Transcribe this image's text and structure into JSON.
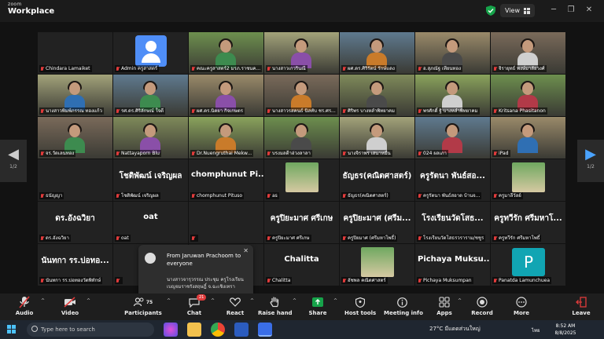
{
  "titlebar": {
    "brand_small": "zoom",
    "brand_big": "Workplace",
    "view_label": "View",
    "colors": {
      "shield": "#16a34a"
    }
  },
  "pager": {
    "left": "1/2",
    "right": "1/2"
  },
  "rows": [
    [
      {
        "label": "Chindara  Lamaiket",
        "type": "name"
      },
      {
        "label": "Admin ครูสาสตร์",
        "type": "avatar"
      },
      {
        "label": "คณะครูสาสตร์2 มรภ.ราชนค...",
        "type": "video"
      },
      {
        "label": "นางสาวเกวรินณี",
        "type": "video"
      },
      {
        "label": "ผศ.ดร.ศิริรัตน์ รักษ์แดง",
        "type": "video"
      },
      {
        "label": "อ.สุภณัฐ เทียนทอง",
        "type": "video"
      },
      {
        "label": "จิรายุทธ์ พงษ์มาลัยวงศ์",
        "type": "video"
      }
    ],
    [
      {
        "label": "นางสาวพิมพ์ภรรณ ทองแก้ว",
        "type": "video"
      },
      {
        "label": "รศ.ดร.ศิริลักษณ์ ใจดี",
        "type": "video"
      },
      {
        "label": "ผศ.ดร.นิตยา กิจเกษตร",
        "type": "video"
      },
      {
        "label": "นางสาวรสคนธ์ นิลทับ ชร.ศร...",
        "type": "video"
      },
      {
        "label": "ศิริพร บางหลำพิทยาคม",
        "type": "video"
      },
      {
        "label": "พรศักดิ์ ฐิ บางหลำพิทยาคม",
        "type": "video"
      },
      {
        "label": "Kritsana Phasitanon",
        "type": "video"
      }
    ],
    [
      {
        "label": "จร.วัดเลนทอง",
        "type": "video"
      },
      {
        "label": "Nattayaporn Blu",
        "type": "video"
      },
      {
        "label": "Dr.Nuengruthai Mekw...",
        "type": "video"
      },
      {
        "label": "บรงมลดีาอ่วงลาลา",
        "type": "video"
      },
      {
        "label": "นางจิราพร เสนาหมื่น",
        "type": "video"
      },
      {
        "label": "024 ผลเภา",
        "type": "video"
      },
      {
        "label": "iPad",
        "type": "video"
      }
    ],
    [
      {
        "label": "ธนัญญา",
        "big": "",
        "type": "name"
      },
      {
        "label": "โชติพัฒน์ เจริญผล",
        "big": "โชติพัฒน์ เจริญผล",
        "type": "name"
      },
      {
        "label": "chomphunut Pituso",
        "big": "chomphunut Pi...",
        "type": "name"
      },
      {
        "label": "as",
        "big": "",
        "type": "photo"
      },
      {
        "label": "ธัญธร(คณิตศาสตร์)",
        "big": "ธัญธร(คณิตศาสตร์)",
        "type": "name"
      },
      {
        "label": "ครูรัตนา  พันธ์สอาด บ้านจ...",
        "big": "ครูรัตนา  พันธ์สอ...",
        "type": "name"
      },
      {
        "label": "ครูมาลีวัลย์",
        "big": "",
        "type": "photo"
      }
    ],
    [
      {
        "label": "ดร.อังฉวิยา",
        "big": "ดร.อังฉวิยา",
        "type": "name"
      },
      {
        "label": "oat",
        "big": "oat",
        "type": "name"
      },
      {
        "label": "",
        "big": "",
        "type": "name"
      },
      {
        "label": "ครูปิยะมาศ ศรีเกษ",
        "big": "ครูปิยะมาศ ศรีเกษ",
        "type": "name"
      },
      {
        "label": "ครูปิยมาศ (ศรีมหาโพธิ์)",
        "big": "ครูปิยะมาศ (ศรีม...",
        "type": "name"
      },
      {
        "label": "โรงเรียนวัดโสธรวราราม/ชชูร",
        "big": "โรงเรียนวัดโสธ...",
        "type": "name"
      },
      {
        "label": "ครูทวีรัก ศรีมหาโพธิ์",
        "big": "ครูทวีรัก ศรีมหาโ...",
        "type": "name"
      }
    ],
    [
      {
        "label": "นันทกา รร.บ่อทองวัดพิทักษ์",
        "big": "นันทกา รร.บ่อทอ...",
        "type": "name"
      },
      {
        "label": "",
        "big": "นางส",
        "type": "name"
      },
      {
        "label": "",
        "big": "",
        "type": "name"
      },
      {
        "label": "Chalitta",
        "big": "Chalitta",
        "type": "name"
      },
      {
        "label": "อัชพล คณิตศาสตร์",
        "big": "",
        "type": "photo"
      },
      {
        "label": "Pichaya Muksumpan",
        "big": "Pichaya  Muksu...",
        "type": "name"
      },
      {
        "label": "Panatda Lamunchuea",
        "big": "P",
        "type": "letter"
      }
    ]
  ],
  "chat": {
    "from": "From Jaruwan Prachoom to everyone",
    "message": "นางสาวจารุวรรณ ประชุม  ครูโรงเรียนเบญจมราชรังสฤษฎิ์ จ.ฉะเชิงเทรา"
  },
  "toolbar": {
    "audio": "Audio",
    "video": "Video",
    "participants": "Participants",
    "participants_count": "75",
    "chat": "Chat",
    "chat_badge": "21",
    "react": "React",
    "raise_hand": "Raise hand",
    "share": "Share",
    "host_tools": "Host tools",
    "meeting_info": "Meeting info",
    "apps": "Apps",
    "record": "Record",
    "more": "More",
    "leave": "Leave"
  },
  "taskbar": {
    "search_placeholder": "Type here to search",
    "weather": "27°C  มีแดดส่วนใหญ่",
    "language": "ไทย",
    "time": "8:52 AM",
    "date": "8/8/2025"
  }
}
